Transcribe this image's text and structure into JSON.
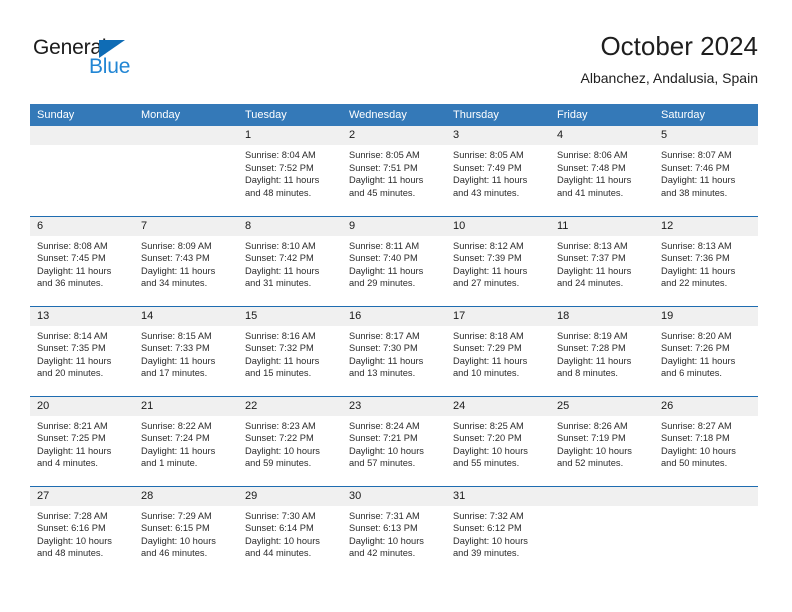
{
  "brand": {
    "name_part1": "General",
    "name_part2": "Blue",
    "triangle_color": "#0f6cb5",
    "blue_color": "#2286d4"
  },
  "header": {
    "title": "October 2024",
    "subtitle": "Albanchez, Andalusia, Spain"
  },
  "theme": {
    "header_blue": "#3479b8",
    "separator_blue": "#1f6cb0",
    "daynum_band": "#f0f0f0"
  },
  "weekday_headers": [
    "Sunday",
    "Monday",
    "Tuesday",
    "Wednesday",
    "Thursday",
    "Friday",
    "Saturday"
  ],
  "weeks": [
    [
      {
        "day": "",
        "empty": true
      },
      {
        "day": "",
        "empty": true
      },
      {
        "day": "1",
        "sunrise": "Sunrise: 8:04 AM",
        "sunset": "Sunset: 7:52 PM",
        "daylight1": "Daylight: 11 hours",
        "daylight2": "and 48 minutes."
      },
      {
        "day": "2",
        "sunrise": "Sunrise: 8:05 AM",
        "sunset": "Sunset: 7:51 PM",
        "daylight1": "Daylight: 11 hours",
        "daylight2": "and 45 minutes."
      },
      {
        "day": "3",
        "sunrise": "Sunrise: 8:05 AM",
        "sunset": "Sunset: 7:49 PM",
        "daylight1": "Daylight: 11 hours",
        "daylight2": "and 43 minutes."
      },
      {
        "day": "4",
        "sunrise": "Sunrise: 8:06 AM",
        "sunset": "Sunset: 7:48 PM",
        "daylight1": "Daylight: 11 hours",
        "daylight2": "and 41 minutes."
      },
      {
        "day": "5",
        "sunrise": "Sunrise: 8:07 AM",
        "sunset": "Sunset: 7:46 PM",
        "daylight1": "Daylight: 11 hours",
        "daylight2": "and 38 minutes."
      }
    ],
    [
      {
        "day": "6",
        "sunrise": "Sunrise: 8:08 AM",
        "sunset": "Sunset: 7:45 PM",
        "daylight1": "Daylight: 11 hours",
        "daylight2": "and 36 minutes."
      },
      {
        "day": "7",
        "sunrise": "Sunrise: 8:09 AM",
        "sunset": "Sunset: 7:43 PM",
        "daylight1": "Daylight: 11 hours",
        "daylight2": "and 34 minutes."
      },
      {
        "day": "8",
        "sunrise": "Sunrise: 8:10 AM",
        "sunset": "Sunset: 7:42 PM",
        "daylight1": "Daylight: 11 hours",
        "daylight2": "and 31 minutes."
      },
      {
        "day": "9",
        "sunrise": "Sunrise: 8:11 AM",
        "sunset": "Sunset: 7:40 PM",
        "daylight1": "Daylight: 11 hours",
        "daylight2": "and 29 minutes."
      },
      {
        "day": "10",
        "sunrise": "Sunrise: 8:12 AM",
        "sunset": "Sunset: 7:39 PM",
        "daylight1": "Daylight: 11 hours",
        "daylight2": "and 27 minutes."
      },
      {
        "day": "11",
        "sunrise": "Sunrise: 8:13 AM",
        "sunset": "Sunset: 7:37 PM",
        "daylight1": "Daylight: 11 hours",
        "daylight2": "and 24 minutes."
      },
      {
        "day": "12",
        "sunrise": "Sunrise: 8:13 AM",
        "sunset": "Sunset: 7:36 PM",
        "daylight1": "Daylight: 11 hours",
        "daylight2": "and 22 minutes."
      }
    ],
    [
      {
        "day": "13",
        "sunrise": "Sunrise: 8:14 AM",
        "sunset": "Sunset: 7:35 PM",
        "daylight1": "Daylight: 11 hours",
        "daylight2": "and 20 minutes."
      },
      {
        "day": "14",
        "sunrise": "Sunrise: 8:15 AM",
        "sunset": "Sunset: 7:33 PM",
        "daylight1": "Daylight: 11 hours",
        "daylight2": "and 17 minutes."
      },
      {
        "day": "15",
        "sunrise": "Sunrise: 8:16 AM",
        "sunset": "Sunset: 7:32 PM",
        "daylight1": "Daylight: 11 hours",
        "daylight2": "and 15 minutes."
      },
      {
        "day": "16",
        "sunrise": "Sunrise: 8:17 AM",
        "sunset": "Sunset: 7:30 PM",
        "daylight1": "Daylight: 11 hours",
        "daylight2": "and 13 minutes."
      },
      {
        "day": "17",
        "sunrise": "Sunrise: 8:18 AM",
        "sunset": "Sunset: 7:29 PM",
        "daylight1": "Daylight: 11 hours",
        "daylight2": "and 10 minutes."
      },
      {
        "day": "18",
        "sunrise": "Sunrise: 8:19 AM",
        "sunset": "Sunset: 7:28 PM",
        "daylight1": "Daylight: 11 hours",
        "daylight2": "and 8 minutes."
      },
      {
        "day": "19",
        "sunrise": "Sunrise: 8:20 AM",
        "sunset": "Sunset: 7:26 PM",
        "daylight1": "Daylight: 11 hours",
        "daylight2": "and 6 minutes."
      }
    ],
    [
      {
        "day": "20",
        "sunrise": "Sunrise: 8:21 AM",
        "sunset": "Sunset: 7:25 PM",
        "daylight1": "Daylight: 11 hours",
        "daylight2": "and 4 minutes."
      },
      {
        "day": "21",
        "sunrise": "Sunrise: 8:22 AM",
        "sunset": "Sunset: 7:24 PM",
        "daylight1": "Daylight: 11 hours",
        "daylight2": "and 1 minute."
      },
      {
        "day": "22",
        "sunrise": "Sunrise: 8:23 AM",
        "sunset": "Sunset: 7:22 PM",
        "daylight1": "Daylight: 10 hours",
        "daylight2": "and 59 minutes."
      },
      {
        "day": "23",
        "sunrise": "Sunrise: 8:24 AM",
        "sunset": "Sunset: 7:21 PM",
        "daylight1": "Daylight: 10 hours",
        "daylight2": "and 57 minutes."
      },
      {
        "day": "24",
        "sunrise": "Sunrise: 8:25 AM",
        "sunset": "Sunset: 7:20 PM",
        "daylight1": "Daylight: 10 hours",
        "daylight2": "and 55 minutes."
      },
      {
        "day": "25",
        "sunrise": "Sunrise: 8:26 AM",
        "sunset": "Sunset: 7:19 PM",
        "daylight1": "Daylight: 10 hours",
        "daylight2": "and 52 minutes."
      },
      {
        "day": "26",
        "sunrise": "Sunrise: 8:27 AM",
        "sunset": "Sunset: 7:18 PM",
        "daylight1": "Daylight: 10 hours",
        "daylight2": "and 50 minutes."
      }
    ],
    [
      {
        "day": "27",
        "sunrise": "Sunrise: 7:28 AM",
        "sunset": "Sunset: 6:16 PM",
        "daylight1": "Daylight: 10 hours",
        "daylight2": "and 48 minutes."
      },
      {
        "day": "28",
        "sunrise": "Sunrise: 7:29 AM",
        "sunset": "Sunset: 6:15 PM",
        "daylight1": "Daylight: 10 hours",
        "daylight2": "and 46 minutes."
      },
      {
        "day": "29",
        "sunrise": "Sunrise: 7:30 AM",
        "sunset": "Sunset: 6:14 PM",
        "daylight1": "Daylight: 10 hours",
        "daylight2": "and 44 minutes."
      },
      {
        "day": "30",
        "sunrise": "Sunrise: 7:31 AM",
        "sunset": "Sunset: 6:13 PM",
        "daylight1": "Daylight: 10 hours",
        "daylight2": "and 42 minutes."
      },
      {
        "day": "31",
        "sunrise": "Sunrise: 7:32 AM",
        "sunset": "Sunset: 6:12 PM",
        "daylight1": "Daylight: 10 hours",
        "daylight2": "and 39 minutes."
      },
      {
        "day": "",
        "empty": true
      },
      {
        "day": "",
        "empty": true
      }
    ]
  ]
}
